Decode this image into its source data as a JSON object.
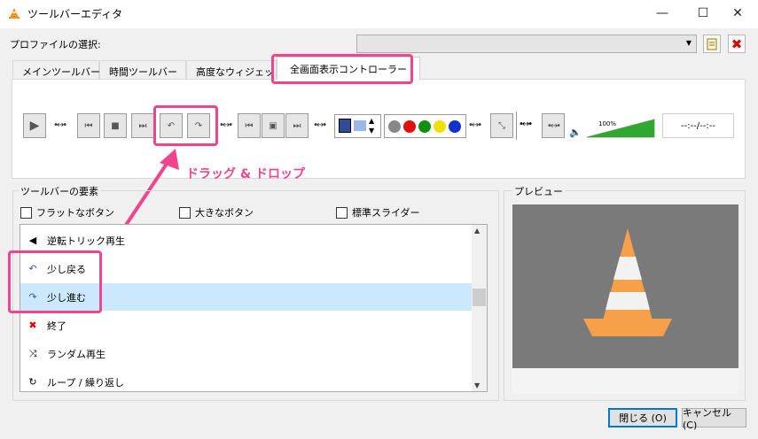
{
  "window": {
    "title": "ツールバーエディタ",
    "minimize": "—",
    "maximize": "☐",
    "close": "✕"
  },
  "profile": {
    "label": "プロファイルの選択:",
    "selected": "",
    "delete_glyph": "✖"
  },
  "tabs": [
    {
      "label": "メインツールバー"
    },
    {
      "label": "時間ツールバー"
    },
    {
      "label": "高度なウィジェット"
    },
    {
      "label": "全画面表示コントローラー"
    }
  ],
  "toolbar_preview": {
    "volume_percent": "100%",
    "volume_level": 1.0,
    "time": "--:--/--:--"
  },
  "annotation": {
    "drag_drop": "ドラッグ & ドロップ"
  },
  "elements": {
    "title": "ツールバーの要素",
    "options": [
      {
        "label": "フラットなボタン"
      },
      {
        "label": "大きなボタン"
      },
      {
        "label": "標準スライダー"
      }
    ],
    "items": [
      {
        "label": "逆転トリック再生"
      },
      {
        "label": "少し戻る"
      },
      {
        "label": "少し進む"
      },
      {
        "label": "終了"
      },
      {
        "label": "ランダム再生"
      },
      {
        "label": "ループ / 繰り返し"
      }
    ]
  },
  "preview": {
    "title": "プレビュー"
  },
  "buttons": {
    "close": "閉じる (O)",
    "cancel": "キャンセル (C)"
  },
  "colors": {
    "highlight": "#f0458c",
    "selection": "#cce8ff",
    "cone_orange": "#f7a04a"
  }
}
